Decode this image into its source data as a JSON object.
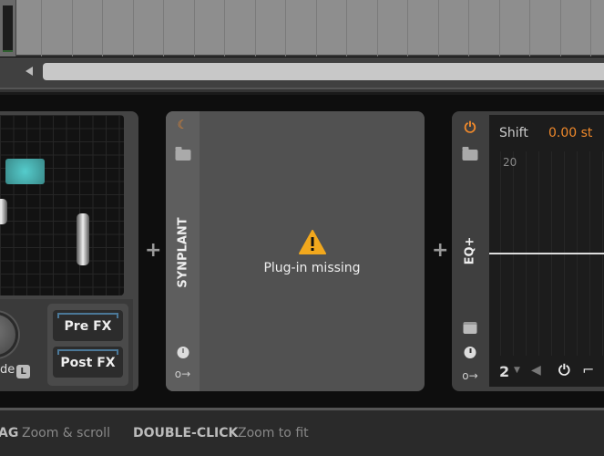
{
  "arranger": {
    "scrollbar": {
      "left_arrow_icon": "triangle-left"
    }
  },
  "devices": {
    "left_device": {
      "mode_label": "de",
      "mode_key": "L",
      "pre_fx": "Pre FX",
      "post_fx": "Post FX",
      "pad_color": "#4fb3b3"
    },
    "synplant": {
      "title": "SYNPLANT",
      "message": "Plug-in missing",
      "power_icon": "moon-icon",
      "warning_color": "#f2a81d"
    },
    "eq_plus": {
      "title": "EQ+",
      "shift_label": "Shift",
      "shift_value": "0.00 st",
      "freq_label": "20",
      "band_number": "2",
      "accent": "#f0892b"
    }
  },
  "add_device_label": "+",
  "status_bar": {
    "hints": [
      {
        "key": "AG",
        "action": "Zoom & scroll"
      },
      {
        "key": "DOUBLE-CLICK",
        "action": "Zoom to fit"
      }
    ]
  }
}
